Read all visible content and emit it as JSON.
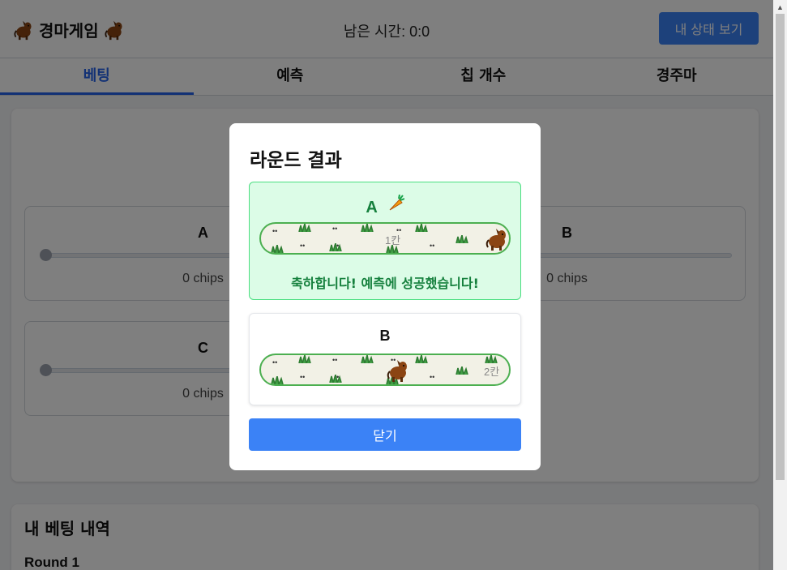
{
  "header": {
    "title": "경마게임",
    "timer": "남은 시간: 0:0",
    "status_button": "내 상태 보기"
  },
  "tabs": [
    {
      "label": "베팅",
      "active": true
    },
    {
      "label": "예측",
      "active": false
    },
    {
      "label": "칩 개수",
      "active": false
    },
    {
      "label": "경주마",
      "active": false
    }
  ],
  "betting": {
    "horses": [
      {
        "name": "A",
        "chips": "0 chips"
      },
      {
        "name": "B",
        "chips": "0 chips"
      },
      {
        "name": "C",
        "chips": "0 chips"
      }
    ]
  },
  "history": {
    "title": "내 베팅 내역",
    "round": "Round 1"
  },
  "modal": {
    "title": "라운드 결과",
    "results": [
      {
        "horse": "A",
        "position_label": "1칸",
        "winner": true,
        "message": "축하합니다! 예측에 성공했습니다!"
      },
      {
        "horse": "B",
        "position_label": "2칸",
        "winner": false
      }
    ],
    "close_button": "닫기"
  },
  "colors": {
    "accent": "#3b82f6",
    "success": "#15803d",
    "success_bg": "#dcfce7",
    "track_border": "#4caf50"
  },
  "icons": [
    "horse-icon",
    "carrot-icon",
    "grass-icon"
  ]
}
